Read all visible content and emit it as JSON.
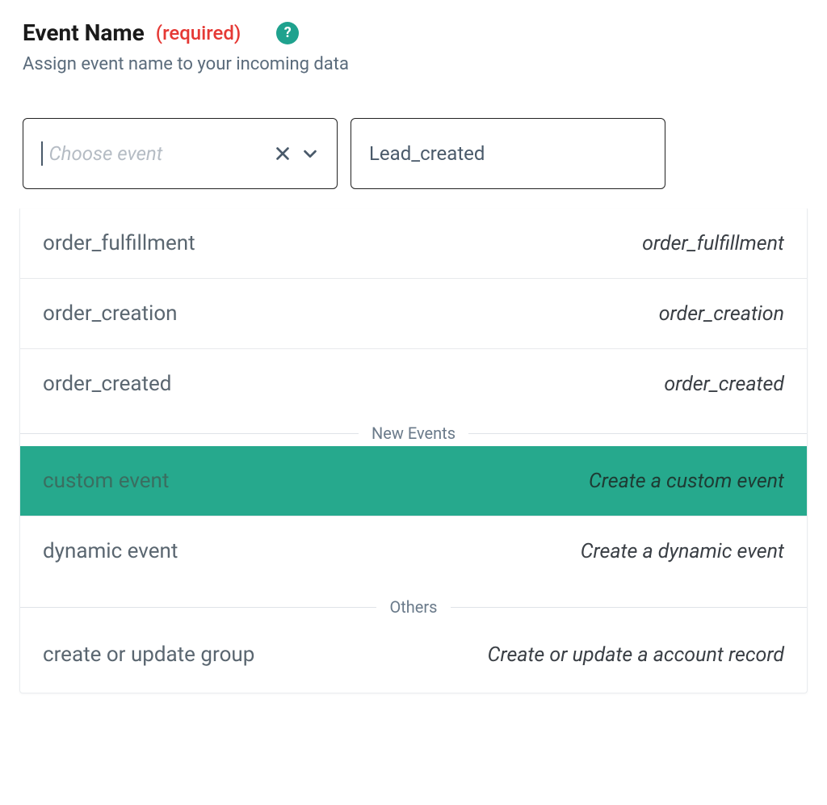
{
  "header": {
    "title": "Event Name",
    "required_label": "(required)",
    "subtitle": "Assign event name to your incoming data"
  },
  "select": {
    "placeholder": "Choose event"
  },
  "input": {
    "value": "Lead_created"
  },
  "dropdown": {
    "items_top": [
      {
        "label": "order_fulfillment",
        "desc": "order_fulfillment"
      },
      {
        "label": "order_creation",
        "desc": "order_creation"
      },
      {
        "label": "order_created",
        "desc": "order_created"
      }
    ],
    "group_new_events": "New Events",
    "items_new": [
      {
        "label": "custom event",
        "desc": "Create a custom event",
        "selected": true
      },
      {
        "label": "dynamic event",
        "desc": "Create a dynamic event"
      }
    ],
    "group_others": "Others",
    "items_others": [
      {
        "label": "create or update group",
        "desc": "Create or update a account record"
      }
    ]
  },
  "icons": {
    "help": "?",
    "clear": "x",
    "chevron": "v"
  }
}
